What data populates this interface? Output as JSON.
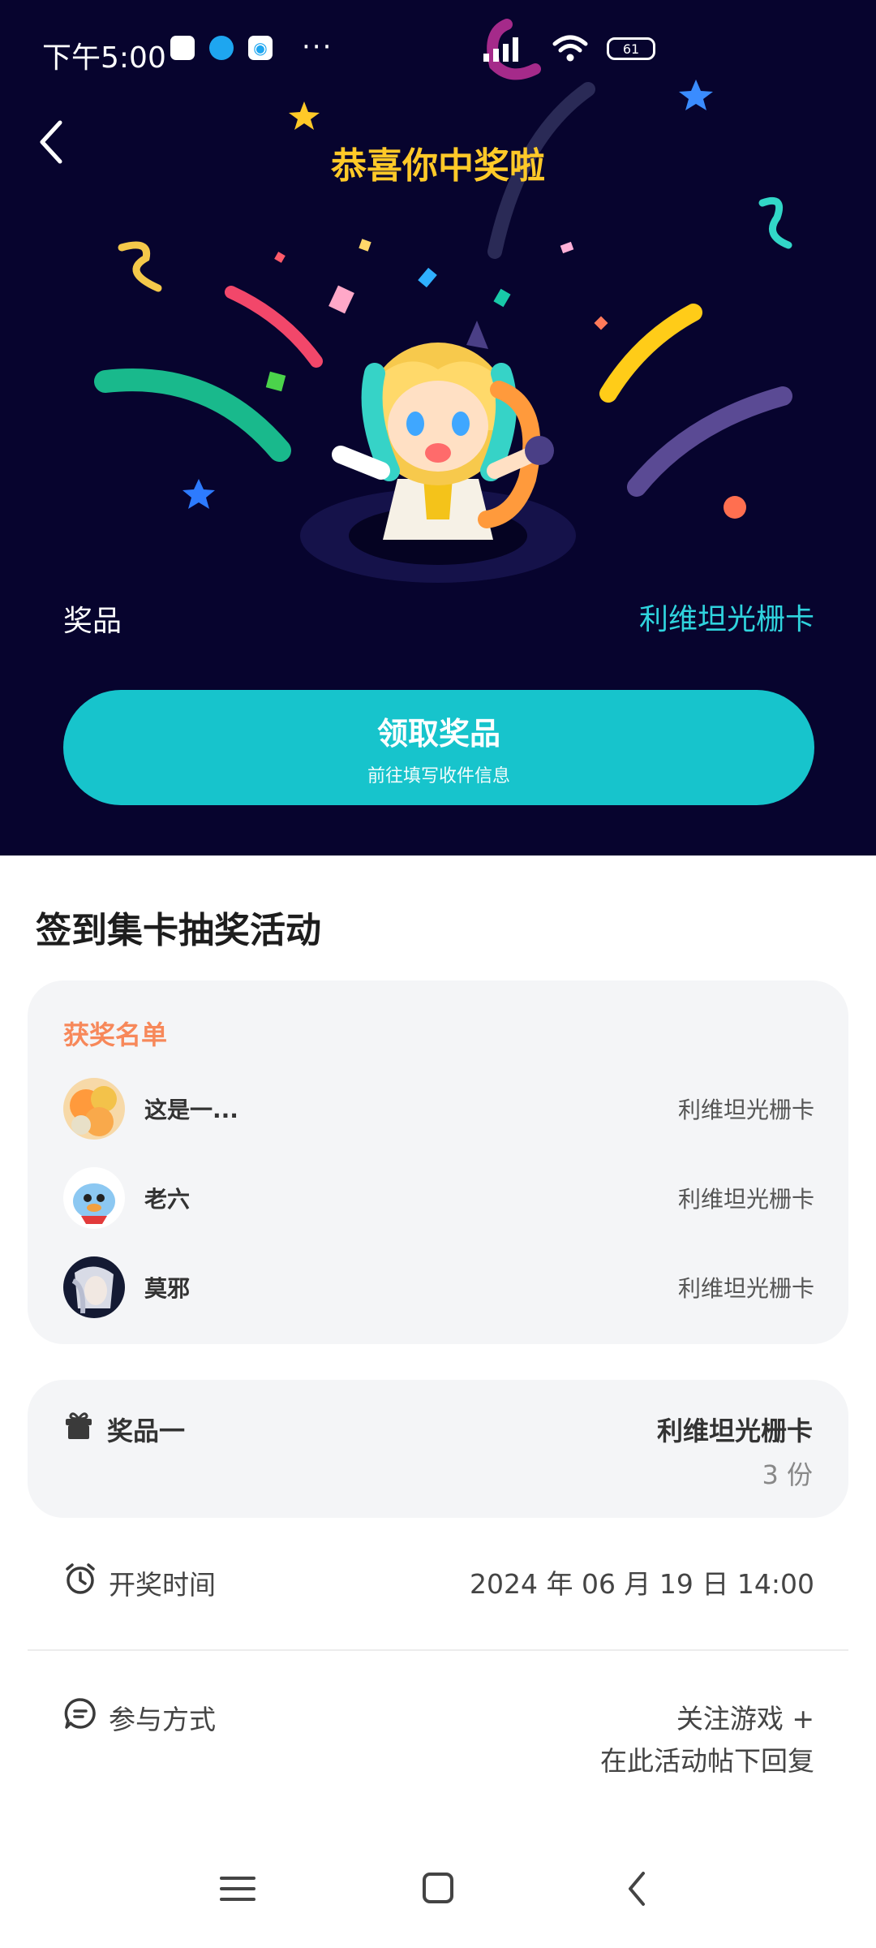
{
  "status_bar": {
    "time": "下午5:00",
    "dots": "···",
    "battery": "61"
  },
  "hero": {
    "title": "恭喜你中奖啦",
    "prize_label": "奖品",
    "prize_value": "利维坦光栅卡",
    "claim_button": {
      "label": "领取奖品",
      "sub_label": "前往填写收件信息"
    }
  },
  "event": {
    "title": "签到集卡抽奖活动",
    "winners": {
      "heading": "获奖名单",
      "items": [
        {
          "name": "这是一...",
          "prize": "利维坦光栅卡"
        },
        {
          "name": "老六",
          "prize": "利维坦光栅卡"
        },
        {
          "name": "莫邪",
          "prize": "利维坦光栅卡"
        }
      ]
    },
    "prize_tier": {
      "label": "奖品一",
      "name": "利维坦光栅卡",
      "count": "3 份"
    },
    "draw_time": {
      "label": "开奖时间",
      "value": "2024 年 06 月 19 日 14:00"
    },
    "participation": {
      "label": "参与方式",
      "line1": "关注游戏 +",
      "line2": "在此活动帖下回复"
    }
  },
  "colors": {
    "hero_bg": "#07042e",
    "title_yellow": "#ffc928",
    "accent_cyan": "#17c4cc",
    "winners_orange": "#f7885a"
  },
  "icons": [
    "back-icon",
    "gift-icon",
    "alarm-clock-icon",
    "chat-bubble-icon",
    "menu-icon",
    "home-icon",
    "nav-back-icon"
  ]
}
